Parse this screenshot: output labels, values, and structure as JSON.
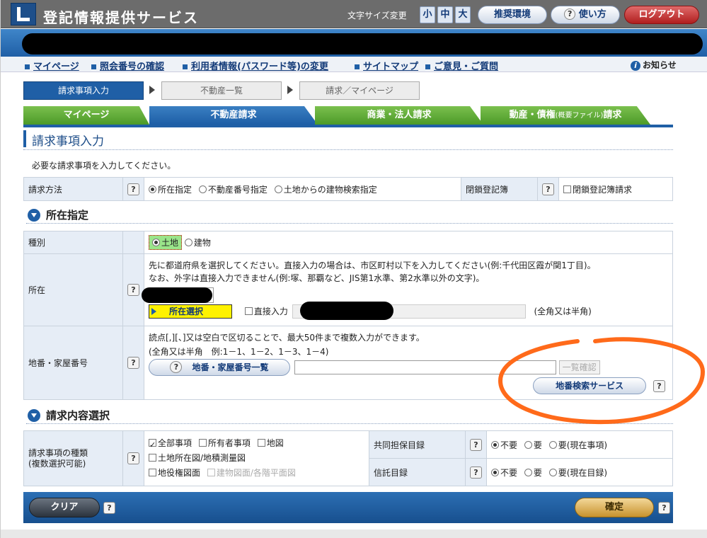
{
  "header": {
    "app_title": "登記情報提供サービス",
    "font_size_label": "文字サイズ変更",
    "font_sizes": [
      "小",
      "中",
      "大"
    ],
    "recommended_env": "推奨環境",
    "help": "使い方",
    "logout": "ログアウト"
  },
  "nav": {
    "links": [
      "マイページ",
      "照会番号の確認",
      "利用者情報(パスワード等)の変更",
      "サイトマップ",
      "ご意見・ご質問"
    ],
    "notice": "お知らせ"
  },
  "steps": [
    "請求事項入力",
    "不動産一覧",
    "請求／マイページ"
  ],
  "tabs": {
    "mypage": "マイページ",
    "realestate": "不動産請求",
    "corporate": "商業・法人請求",
    "movable_main": "動産・債権",
    "movable_small": "(概要ファイル)",
    "movable_suffix": "請求"
  },
  "page_title": "請求事項入力",
  "instruction": "必要な請求事項を入力してください。",
  "request_method": {
    "label": "請求方法",
    "options": [
      "所在指定",
      "不動産番号指定",
      "土地からの建物検索指定"
    ],
    "closed_label": "閉鎖登記簿",
    "closed_option": "閉鎖登記簿請求"
  },
  "location_section": {
    "heading": "所在指定",
    "type_label": "種別",
    "type_options": [
      "土地",
      "建物"
    ],
    "location_label": "所在",
    "location_note1": "先に都道府県を選択してください。直接入力の場合は、市区町村以下を入力してください(例:千代田区霞が関1丁目)。",
    "location_note2": "なお、外字は直接入力できません(例:塚、那覇など、JIS第1水準、第2水準以外の文字)。",
    "select_button": "所在選択",
    "direct_input": "直接入力",
    "width_note": "(全角又は半角)",
    "lot_label": "地番・家屋番号",
    "lot_note1": "読点[,][、]又は空白で区切ることで、最大50件まで複数入力ができます。",
    "lot_note2": "(全角又は半角　例:1－1、1－2、1－3、1－4)",
    "lot_list_button": "地番・家屋番号一覧",
    "list_confirm": "一覧確認",
    "lot_search": "地番検索サービス"
  },
  "content_section": {
    "heading": "請求内容選択",
    "kind_label1": "請求事項の種類",
    "kind_label2": "(複数選択可能)",
    "items": [
      "全部事項",
      "所有者事項",
      "地図",
      "土地所在図/地積測量図",
      "地役権図面",
      "建物図面/各階平面図"
    ],
    "joint_label": "共同担保目録",
    "joint_options": [
      "不要",
      "要",
      "要(現在事項)"
    ],
    "trust_label": "信託目録",
    "trust_options": [
      "不要",
      "要",
      "要(現在目録)"
    ]
  },
  "actions": {
    "clear": "クリア",
    "confirm": "確定"
  },
  "colors": {
    "primary": "#1f5fa6",
    "tab_green": "#5aa833",
    "highlight_yellow": "#fff200",
    "annotation_orange": "#ff6a1a"
  }
}
